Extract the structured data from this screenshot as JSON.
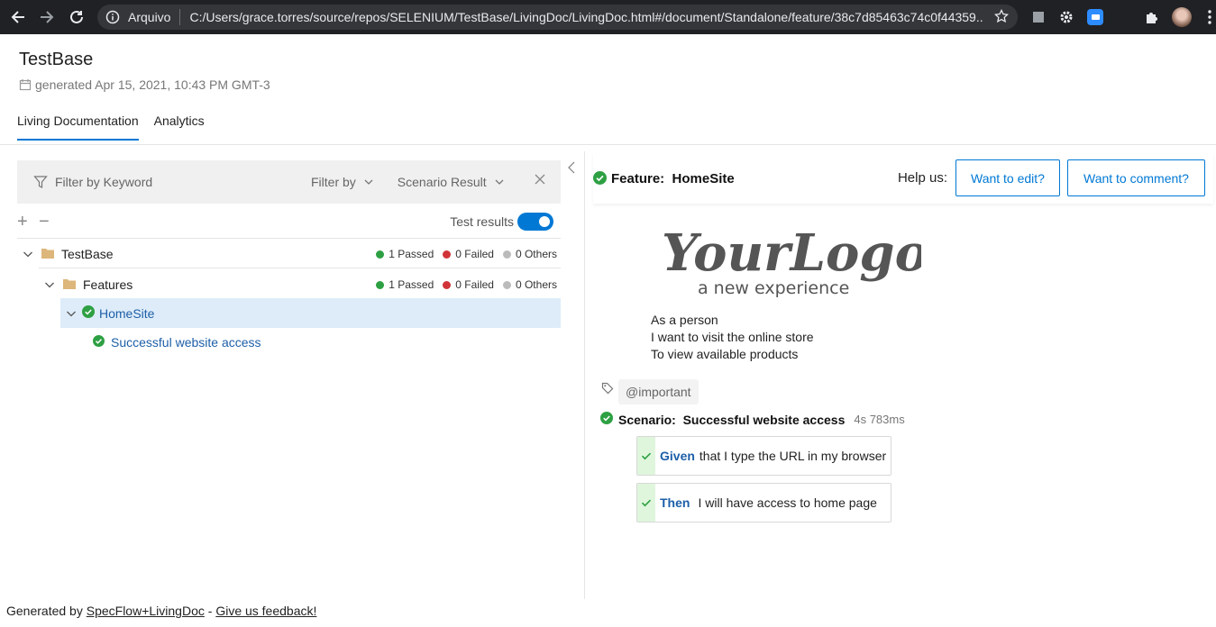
{
  "browser": {
    "scheme": "Arquivo",
    "url": "C:/Users/grace.torres/source/repos/SELENIUM/TestBase/LivingDoc/LivingDoc.html#/document/Standalone/feature/38c7d85463c74c0f44359..."
  },
  "header": {
    "title": "TestBase",
    "generated": "generated Apr 15, 2021, 10:43 PM GMT-3"
  },
  "tabs": [
    {
      "label": "Living Documentation"
    },
    {
      "label": "Analytics"
    }
  ],
  "filter": {
    "keyword_placeholder": "Filter by Keyword",
    "filter_by": "Filter by",
    "scenario_result": "Scenario Result"
  },
  "tree_tools": {
    "plus": "+",
    "minus": "−",
    "test_results_label": "Test results"
  },
  "tree": [
    {
      "label": "TestBase",
      "passed": "1 Passed",
      "failed": "0 Failed",
      "others": "0 Others"
    },
    {
      "label": "Features",
      "passed": "1 Passed",
      "failed": "0 Failed",
      "others": "0 Others"
    },
    {
      "label": "HomeSite"
    },
    {
      "label": "Successful website access"
    }
  ],
  "feature": {
    "title": "Feature:  HomeSite",
    "help_label": "Help us:",
    "edit_button": "Want to edit?",
    "comment_button": "Want to comment?",
    "logo_text": "YourLogo",
    "logo_tagline": "a new experience",
    "description": [
      "As a person",
      "I want to visit the online store",
      "To view available products"
    ],
    "tag": "@important",
    "scenario_title": "Scenario:  Successful website access",
    "scenario_duration": "4s 783ms",
    "steps": [
      {
        "keyword": "Given",
        "text": "that I type the URL in my browser"
      },
      {
        "keyword": "Then",
        "text": "I will have access to home page"
      }
    ]
  },
  "footer": {
    "prefix": "Generated by",
    "link1": "SpecFlow+LivingDoc",
    "dash": "-",
    "link2": "Give us feedback!"
  },
  "colors": {
    "accent": "#0078d4",
    "passed": "#2ea043",
    "failed": "#d13438",
    "others": "#bbbbbb"
  }
}
